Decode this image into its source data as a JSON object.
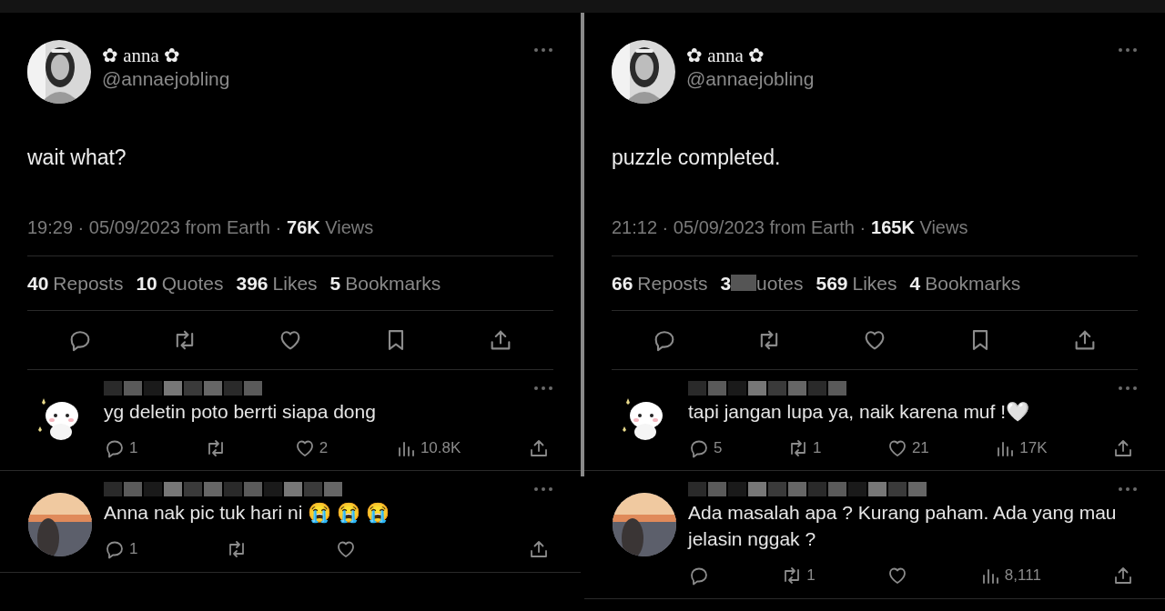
{
  "panels": [
    {
      "tweet": {
        "display_name": "✿ anna ✿",
        "handle": "@annaejobling",
        "text": "wait what?",
        "time": "19:29 · 05/09/2023 from Earth ·",
        "views_count": "76K",
        "views_label": "Views",
        "stats": [
          {
            "count": "40",
            "label": "Reposts"
          },
          {
            "count": "10",
            "label": "Quotes"
          },
          {
            "count": "396",
            "label": "Likes"
          },
          {
            "count": "5",
            "label": "Bookmarks"
          }
        ],
        "actions": [
          {
            "kind": "reply"
          },
          {
            "kind": "repost"
          },
          {
            "kind": "like"
          },
          {
            "kind": "bookmark"
          },
          {
            "kind": "share"
          }
        ]
      },
      "replies": [
        {
          "avatar": {
            "kind": "cat"
          },
          "text": "yg deletin poto berrti siapa dong",
          "actions": [
            {
              "kind": "reply",
              "count": "1"
            },
            {
              "kind": "repost"
            },
            {
              "kind": "like",
              "count": "2"
            },
            {
              "kind": "views",
              "count": "10.8K"
            },
            {
              "kind": "share"
            }
          ]
        },
        {
          "text": "Anna nak pic tuk hari ni 😭 😭 😭",
          "actions": [
            {
              "kind": "reply",
              "count": "1"
            },
            {
              "kind": "repost"
            },
            {
              "kind": "like"
            },
            {
              "kind": "blank"
            },
            {
              "kind": "share"
            }
          ]
        }
      ]
    },
    {
      "tweet": {
        "display_name": "✿ anna ✿",
        "handle": "@annaejobling",
        "text": "puzzle completed.",
        "time": "21:12 · 05/09/2023 from Earth ·",
        "views_count": "165K",
        "views_label": "Views",
        "stats": [
          {
            "count": "66",
            "label": "Reposts"
          },
          {
            "count": "3",
            "label": "uotes",
            "redacted": true
          },
          {
            "count": "569",
            "label": "Likes"
          },
          {
            "count": "4",
            "label": "Bookmarks"
          }
        ],
        "actions": [
          {
            "kind": "reply"
          },
          {
            "kind": "repost"
          },
          {
            "kind": "like"
          },
          {
            "kind": "bookmark"
          },
          {
            "kind": "share"
          }
        ]
      },
      "replies": [
        {
          "avatar": {
            "kind": "cat"
          },
          "text": "tapi jangan lupa ya, naik karena muf !🤍",
          "actions": [
            {
              "kind": "reply",
              "count": "5"
            },
            {
              "kind": "repost",
              "count": "1"
            },
            {
              "kind": "like",
              "count": "21"
            },
            {
              "kind": "views",
              "count": "17K"
            },
            {
              "kind": "share"
            }
          ]
        },
        {
          "text": "Ada masalah apa ? Kurang paham. Ada yang mau jelasin nggak ?",
          "actions": [
            {
              "kind": "reply"
            },
            {
              "kind": "repost",
              "count": "1"
            },
            {
              "kind": "like"
            },
            {
              "kind": "views",
              "count": "8,111"
            },
            {
              "kind": "share"
            }
          ]
        }
      ]
    }
  ]
}
